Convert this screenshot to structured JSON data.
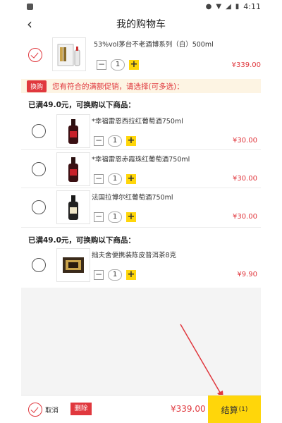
{
  "status_bar": {
    "time": "4:11"
  },
  "header": {
    "back_icon": "chevron-left-icon",
    "title": "我的购物车"
  },
  "main_item": {
    "name": "53%vol茅台不老酒博系列（白）500ml",
    "quantity": "1",
    "price": "¥339.00",
    "selected": true
  },
  "promo": {
    "tag": "换购",
    "text": "您有符合的满额促销，请选择(可多选)："
  },
  "groups": [
    {
      "title": "已满49.0元，可换购以下商品：",
      "items": [
        {
          "name": "*幸福雷恩西拉红葡萄酒750ml",
          "quantity": "1",
          "price": "¥30.00"
        },
        {
          "name": "*幸福雷恩赤霞珠红葡萄酒750ml",
          "quantity": "1",
          "price": "¥30.00"
        },
        {
          "name": "法国拉博尔红葡萄酒750ml",
          "quantity": "1",
          "price": "¥30.00"
        }
      ]
    },
    {
      "title": "已满49.0元，可换购以下商品：",
      "items": [
        {
          "name": "拙夫舍便携装陈皮普洱茶8克",
          "quantity": "1",
          "price": "¥9.90"
        }
      ]
    }
  ],
  "bottom": {
    "cancel_label": "取消",
    "delete_label": "删除",
    "total": "¥339.00",
    "checkout_label": "结算",
    "checkout_count": "(1)"
  },
  "colors": {
    "accent": "#e0383e",
    "highlight": "#ffd60a",
    "promo_bg": "#fdf4e3"
  }
}
